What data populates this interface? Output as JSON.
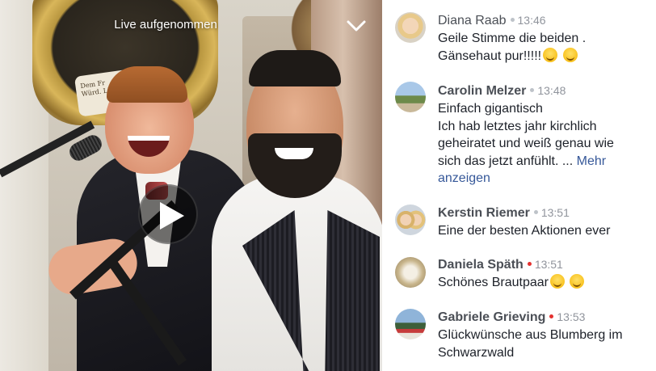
{
  "video": {
    "title": "Live aufgenommen",
    "chevron_icon": "chevron-down-icon",
    "play_icon": "play-icon"
  },
  "colors": {
    "name": "#4b4f56",
    "time": "#90949c",
    "text": "#1d2129",
    "link": "#365899",
    "dot_gray": "#bec3c9",
    "dot_red": "#e4312f"
  },
  "comments": [
    {
      "name": "Diana Raab",
      "time": "13:46",
      "dot": "gray",
      "lines": [
        "Geile Stimme die beiden .",
        "Gänsehaut pur!!!!!"
      ],
      "emoji_count": 2,
      "more": ""
    },
    {
      "name": "Carolin Melzer",
      "time": "13:48",
      "dot": "gray",
      "lines": [
        "Einfach gigantisch",
        "Ich hab letztes jahr kirchlich",
        "geheiratet und weiß genau wie",
        "sich das jetzt anfühlt. ..."
      ],
      "more_a": "Mehr",
      "more_b": "anzeigen"
    },
    {
      "name": "Kerstin Riemer",
      "time": "13:51",
      "dot": "gray",
      "lines": [
        "Eine der besten Aktionen ever"
      ]
    },
    {
      "name": "Daniela Späth",
      "time": "13:51",
      "dot": "red",
      "lines": [
        "Schönes Brautpaar"
      ],
      "emoji_count": 2
    },
    {
      "name": "Gabriele Grieving",
      "time": "13:53",
      "dot": "red",
      "lines": [
        "Glückwünsche aus Blumberg im",
        "Schwarzwald"
      ]
    }
  ],
  "plaque": "Dem Fr... Würd. Lit. ..."
}
